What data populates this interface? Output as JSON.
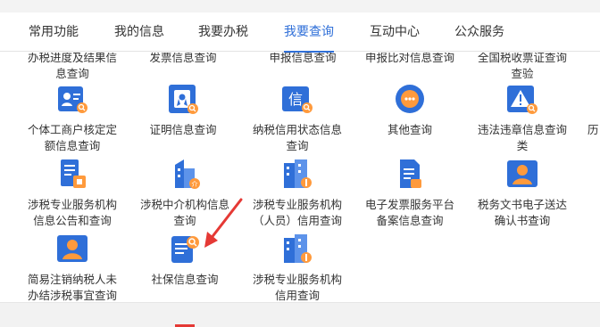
{
  "nav": {
    "tabs": [
      {
        "label": "常用功能"
      },
      {
        "label": "我的信息"
      },
      {
        "label": "我要办税"
      },
      {
        "label": "我要查询"
      },
      {
        "label": "互动中心"
      },
      {
        "label": "公众服务"
      }
    ],
    "active": "我要查询"
  },
  "colors": {
    "accent": "#2f6fd8",
    "icon_bg": "#2f6fd8",
    "icon_sub": "#ff9a3c",
    "arrow": "#e53935"
  },
  "rows": [
    {
      "tiles": [
        {
          "label": "办税进度及结果信息查询",
          "icon": "progress-search-icon"
        },
        {
          "label": "发票信息查询",
          "icon": "invoice-search-icon"
        },
        {
          "label": "申报信息查询",
          "icon": "declaration-search-icon"
        },
        {
          "label": "申报比对信息查询",
          "icon": "compare-search-icon"
        },
        {
          "label": "全国税收票证查询查验",
          "icon": "voucher-search-icon"
        }
      ]
    },
    {
      "tiles": [
        {
          "label": "个体工商户核定定额信息查询",
          "icon": "business-id-icon"
        },
        {
          "label": "证明信息查询",
          "icon": "certificate-icon"
        },
        {
          "label": "纳税信用状态信息查询",
          "icon": "credit-status-icon"
        },
        {
          "label": "其他查询",
          "icon": "other-search-icon"
        },
        {
          "label": "违法违章信息查询类",
          "icon": "warning-icon"
        },
        {
          "label": "历",
          "icon": ""
        }
      ]
    },
    {
      "tiles": [
        {
          "label": "涉税专业服务机构信息公告和查询",
          "icon": "agency-notice-icon"
        },
        {
          "label": "涉税中介机构信息查询",
          "icon": "intermediary-icon"
        },
        {
          "label": "涉税专业服务机构（人员）信用查询",
          "icon": "agency-credit-icon"
        },
        {
          "label": "电子发票服务平台备案信息查询",
          "icon": "e-invoice-icon"
        },
        {
          "label": "税务文书电子送达确认书查询",
          "icon": "document-delivery-icon"
        }
      ]
    },
    {
      "tiles": [
        {
          "label": "简易注销纳税人未办结涉税事宜查询",
          "icon": "deregistration-icon"
        },
        {
          "label": "社保信息查询",
          "icon": "social-security-icon"
        },
        {
          "label": "涉税专业服务机构信用查询",
          "icon": "agency-credit-2-icon"
        }
      ]
    }
  ]
}
